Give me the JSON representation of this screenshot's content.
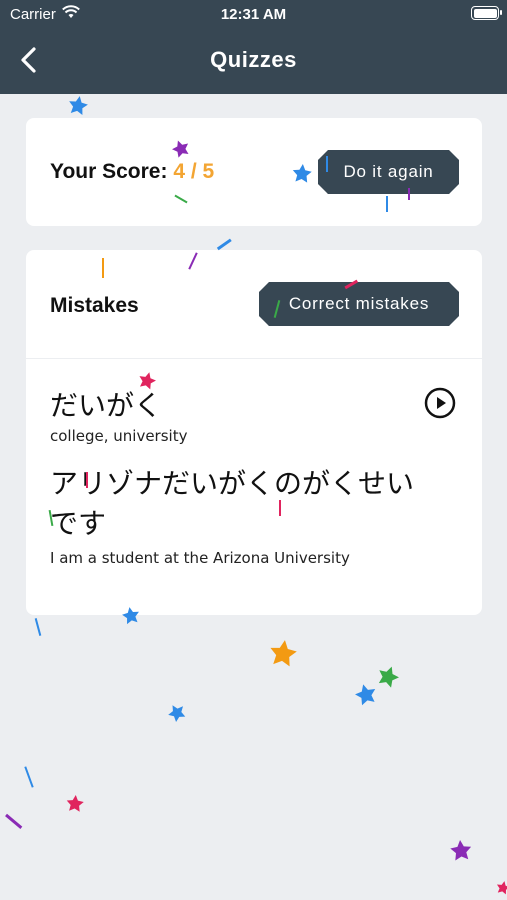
{
  "status_bar": {
    "carrier": "Carrier",
    "time": "12:31 AM"
  },
  "nav": {
    "title": "Quizzes",
    "back_icon": "chevron-left-icon"
  },
  "score": {
    "label": "Your Score:",
    "value": "4 / 5",
    "value_color": "#f3a533",
    "retry_label": "Do it again"
  },
  "mistakes": {
    "title": "Mistakes",
    "correct_label": "Correct mistakes",
    "item": {
      "word": "だいがく",
      "meaning": "college, university",
      "sentence": "アリゾナだいがくのがくせいです",
      "sentence_meaning": "I am a student at the Arizona University",
      "play_icon": "play-icon"
    }
  },
  "colors": {
    "header": "#374753",
    "background": "#eceef1",
    "accent": "#f3a533"
  }
}
